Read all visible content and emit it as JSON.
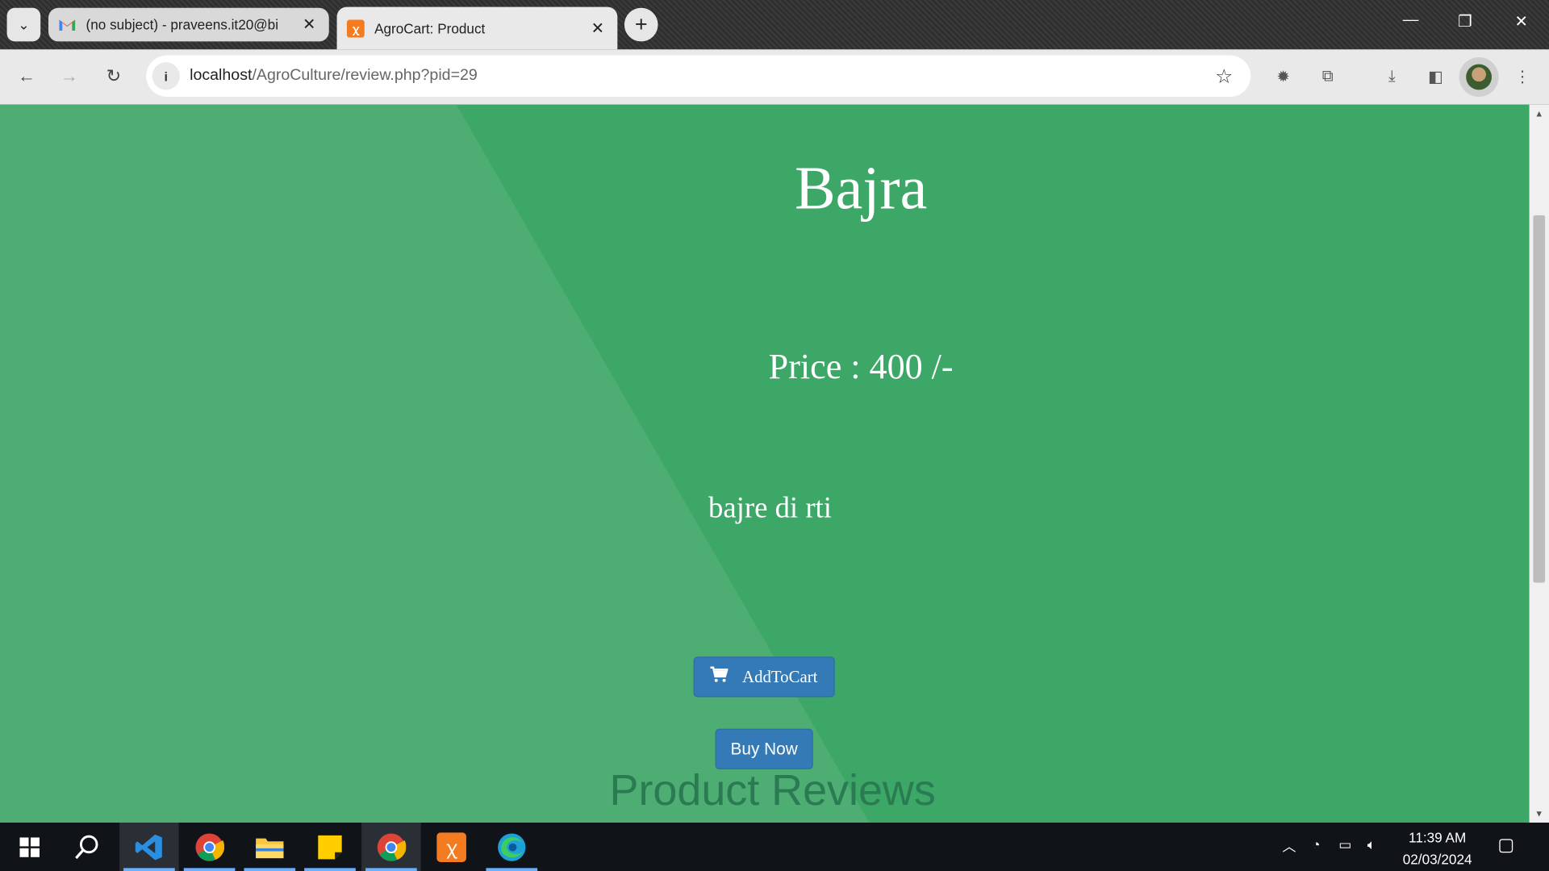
{
  "browser": {
    "tabs": [
      {
        "title": "(no subject) - praveens.it20@bi",
        "favicon": "gmail-icon"
      },
      {
        "title": "AgroCart: Product",
        "favicon": "xampp-icon"
      }
    ],
    "url_host": "localhost",
    "url_path": "/AgroCulture/review.php?pid=29"
  },
  "product": {
    "name": "Bajra",
    "price_label": "Price : 400 /-",
    "description": "bajre di rti",
    "add_to_cart_label": "AddToCart",
    "buy_now_label": "Buy Now",
    "reviews_heading": "Product Reviews"
  },
  "colors": {
    "page_bg": "#3ca766",
    "page_bg_light": "#4dad73",
    "button": "#337ab7"
  },
  "taskbar": {
    "apps": [
      "windows-start-icon",
      "search-icon",
      "vscode-icon",
      "chrome-icon",
      "file-explorer-icon",
      "sticky-notes-icon",
      "chrome-icon",
      "xampp-icon",
      "edge-icon"
    ],
    "time": "11:39 AM",
    "date": "02/03/2024"
  }
}
